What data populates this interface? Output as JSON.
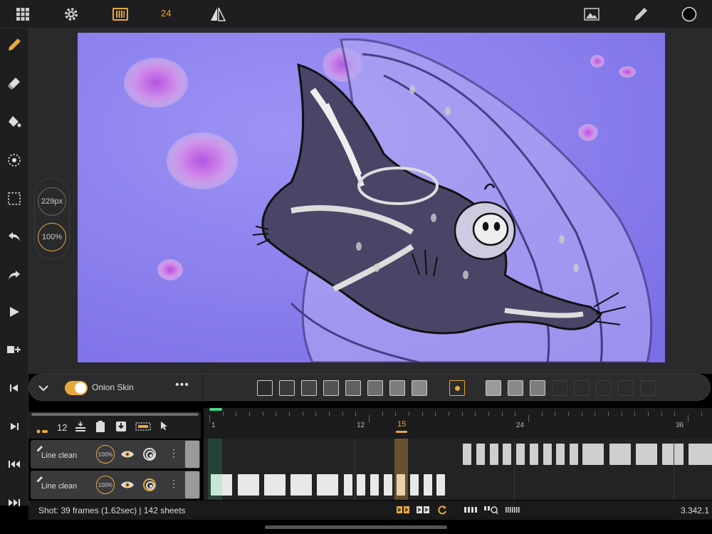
{
  "toolbar": {
    "fps": "24",
    "icons": [
      "grid-icon",
      "gear-icon",
      "film-strip-icon",
      "flip-icon",
      "image-icon",
      "brush-icon",
      "color-swatch-icon"
    ]
  },
  "sidebar": {
    "tools": [
      "pencil-icon",
      "eraser-icon",
      "fill-icon",
      "lasso-icon",
      "select-icon",
      "undo-icon",
      "redo-icon",
      "play-icon",
      "add-frame-icon",
      "first-frame-icon",
      "next-frame-icon",
      "prev-key-icon",
      "next-key-icon"
    ]
  },
  "brush": {
    "size_label": "229px",
    "opacity_label": "100%"
  },
  "onion": {
    "label": "Onion Skin",
    "enabled": true,
    "more": "•••"
  },
  "timeline": {
    "frames_per_page": "12",
    "ruler": [
      "1",
      "12",
      "15",
      "24",
      "36"
    ],
    "current_frame": "15",
    "layers": [
      {
        "name": "Line clean",
        "opacity": "100%"
      },
      {
        "name": "Line clean",
        "opacity": "100%"
      }
    ]
  },
  "status": {
    "info": "Shot: 39 frames (1.62sec) | 142 sheets",
    "value": "3.342.1"
  },
  "colors": {
    "accent": "#e8a93c",
    "canvas_bg": "#8b7ff0",
    "panel": "#1e1e20"
  }
}
